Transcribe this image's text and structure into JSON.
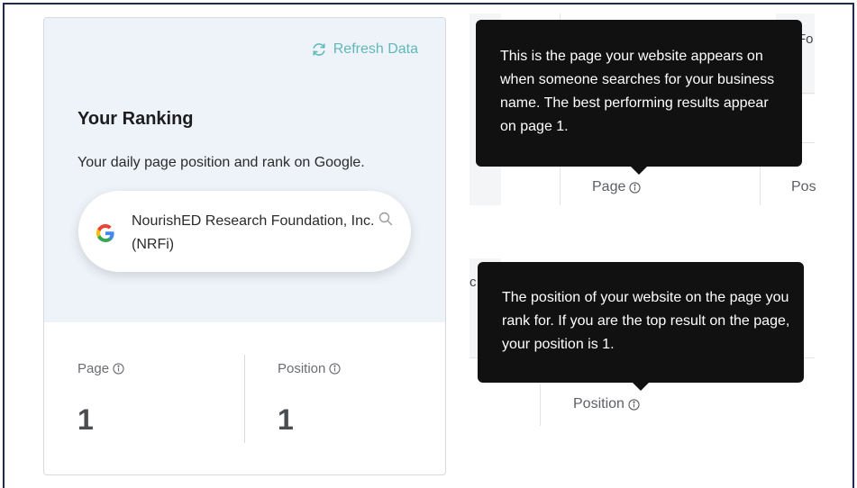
{
  "ranking_card": {
    "refresh_label": "Refresh Data",
    "title": "Your Ranking",
    "subtitle": "Your daily page position and rank on Google.",
    "search_query": "NourishED Research Foundation, Inc. (NRFi)",
    "page_label": "Page",
    "page_value": "1",
    "position_label": "Position",
    "position_value": "1"
  },
  "tooltip_page": {
    "text": "This is the page your website appears on when someone searches for your business name. The best performing results appear on page 1.",
    "column_label": "Page",
    "next_column_partial": "Pos",
    "partial_header": "Fo"
  },
  "tooltip_position": {
    "text": "The position of your website on the page you rank for. If you are the top result on the page, your position is 1.",
    "column_label": "Position",
    "partial_left": "c"
  },
  "colors": {
    "accent_teal": "#5fb8b9",
    "card_top_bg": "#eef3f9",
    "tooltip_bg": "#111111",
    "frame_border": "#1d2b4f"
  },
  "icons": [
    "refresh-icon",
    "google-logo-icon",
    "search-icon",
    "info-icon"
  ]
}
